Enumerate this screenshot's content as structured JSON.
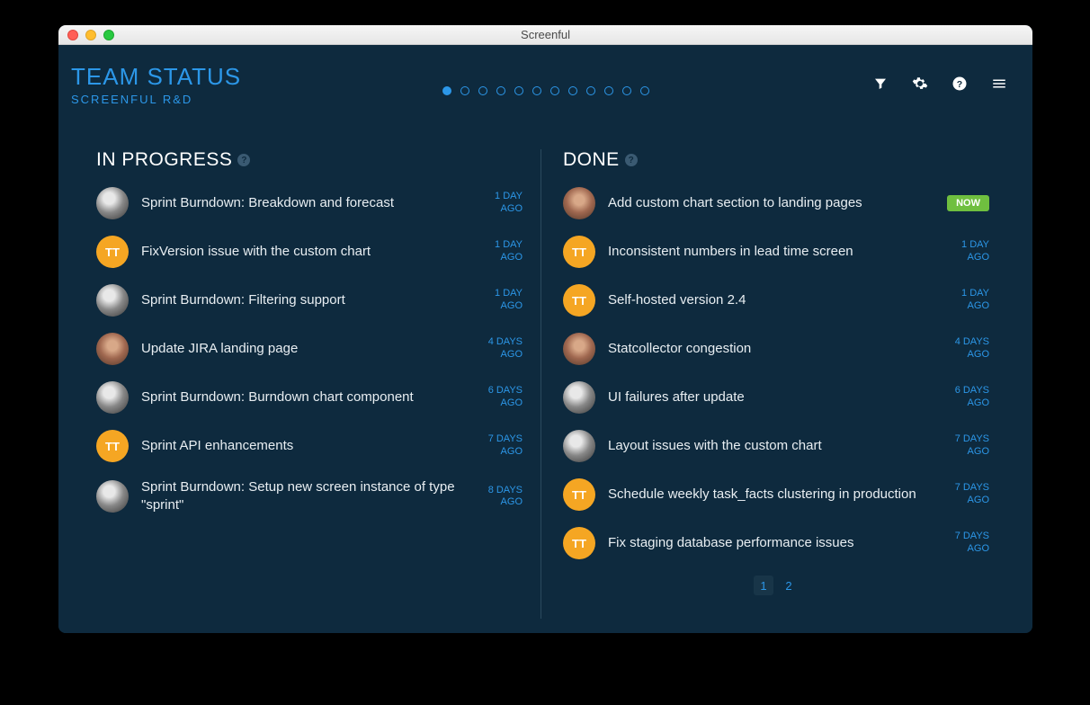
{
  "window": {
    "title": "Screenful"
  },
  "header": {
    "title": "TEAM STATUS",
    "subtitle": "SCREENFUL R&D",
    "dot_count": 12,
    "active_dot": 0
  },
  "columns": {
    "in_progress": {
      "title": "IN PROGRESS",
      "tasks": [
        {
          "avatar": "face1",
          "title": "Sprint Burndown: Breakdown and forecast",
          "time_l1": "1 DAY",
          "time_l2": "AGO"
        },
        {
          "avatar": "tt",
          "initials": "TT",
          "title": "FixVersion issue with the custom chart",
          "time_l1": "1 DAY",
          "time_l2": "AGO"
        },
        {
          "avatar": "face1",
          "title": "Sprint Burndown: Filtering support",
          "time_l1": "1 DAY",
          "time_l2": "AGO"
        },
        {
          "avatar": "photo2",
          "title": "Update JIRA landing page",
          "time_l1": "4 DAYS",
          "time_l2": "AGO"
        },
        {
          "avatar": "face1",
          "title": "Sprint Burndown: Burndown chart component",
          "time_l1": "6 DAYS",
          "time_l2": "AGO"
        },
        {
          "avatar": "tt",
          "initials": "TT",
          "title": "Sprint API enhancements",
          "time_l1": "7 DAYS",
          "time_l2": "AGO"
        },
        {
          "avatar": "face1",
          "title": "Sprint Burndown: Setup new screen instance of type \"sprint\"",
          "time_l1": "8 DAYS",
          "time_l2": "AGO"
        }
      ]
    },
    "done": {
      "title": "DONE",
      "tasks": [
        {
          "avatar": "photo2",
          "title": "Add custom chart section to landing pages",
          "now_badge": "NOW"
        },
        {
          "avatar": "tt",
          "initials": "TT",
          "title": "Inconsistent numbers in lead time screen",
          "time_l1": "1 DAY",
          "time_l2": "AGO"
        },
        {
          "avatar": "tt",
          "initials": "TT",
          "title": "Self-hosted version 2.4",
          "time_l1": "1 DAY",
          "time_l2": "AGO"
        },
        {
          "avatar": "photo2",
          "title": "Statcollector congestion",
          "time_l1": "4 DAYS",
          "time_l2": "AGO"
        },
        {
          "avatar": "face1",
          "title": "UI failures after update",
          "time_l1": "6 DAYS",
          "time_l2": "AGO"
        },
        {
          "avatar": "face1",
          "title": "Layout issues with the custom chart",
          "time_l1": "7 DAYS",
          "time_l2": "AGO"
        },
        {
          "avatar": "tt",
          "initials": "TT",
          "title": "Schedule weekly task_facts clustering in production",
          "time_l1": "7 DAYS",
          "time_l2": "AGO"
        },
        {
          "avatar": "tt",
          "initials": "TT",
          "title": "Fix staging database performance issues",
          "time_l1": "7 DAYS",
          "time_l2": "AGO"
        }
      ],
      "pages": [
        "1",
        "2"
      ],
      "active_page": 0
    }
  }
}
